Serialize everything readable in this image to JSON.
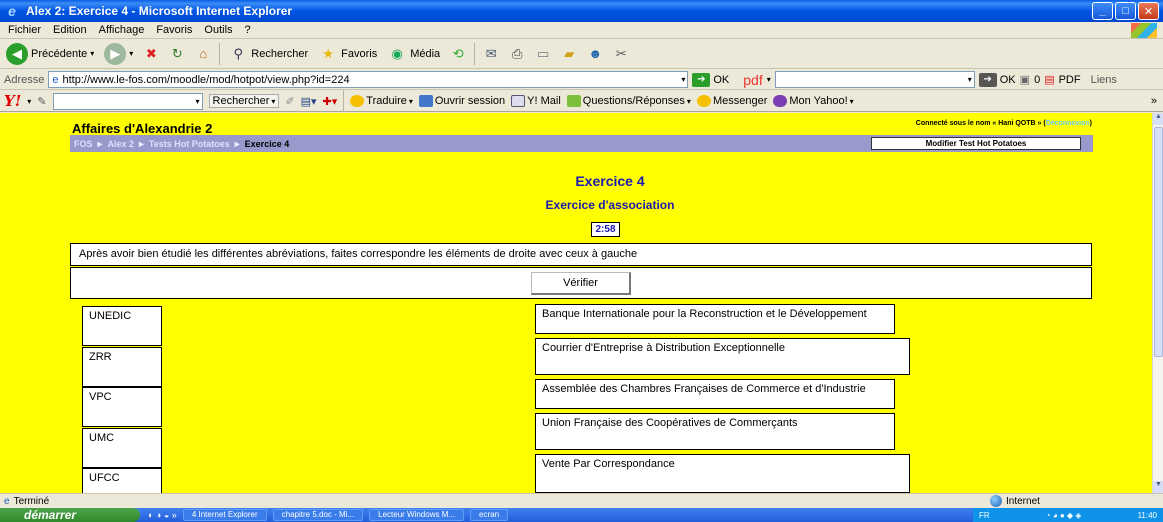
{
  "window": {
    "title": "Alex 2: Exercice 4 - Microsoft Internet Explorer"
  },
  "menu": [
    "Fichier",
    "Edition",
    "Affichage",
    "Favoris",
    "Outils",
    "?"
  ],
  "toolbar": {
    "back": "Précédente",
    "search": "Rechercher",
    "favorites": "Favoris",
    "media": "Média"
  },
  "address": {
    "label": "Adresse",
    "url": "http://www.le-fos.com/moodle/mod/hotpot/view.php?id=224",
    "go": "OK",
    "pdf_brand": "pdf",
    "go2": "OK",
    "count": "0",
    "pdf_label": "PDF",
    "links": "Liens"
  },
  "yahoo": {
    "search_btn": "Rechercher",
    "translate": "Traduire",
    "open_session": "Ouvrir session",
    "mail": "Y! Mail",
    "qa": "Questions/Réponses",
    "messenger": "Messenger",
    "my_yahoo": "Mon Yahoo!"
  },
  "page": {
    "site_title": "Affaires d'Alexandrie 2",
    "login_text": "Connecté sous le nom « Hani QOTB » (",
    "logout": "Déconnexion",
    "login_close": ")",
    "breadcrumb": [
      "FOS",
      "Alex 2",
      "Tests Hot Potatoes",
      "Exercice 4"
    ],
    "breadcrumb_sep": "►",
    "edit_button": "Modifier Test Hot Potatoes",
    "exercise_title": "Exercice 4",
    "exercise_subtitle": "Exercice d'association",
    "timer": "2:58",
    "instructions": "Après avoir bien étudié les différentes abréviations, faites correspondre les éléments de droite avec ceux à gauche",
    "check_button": "Vérifier",
    "left_items": [
      "UNEDIC",
      "ZRR",
      "VPC",
      "UMC",
      "UFCC"
    ],
    "right_items": [
      "Banque Internationale pour la Reconstruction et le Développement",
      "Courrier d'Entreprise à Distribution Exceptionnelle",
      "Assemblée des Chambres Françaises de Commerce et d'Industrie",
      "Union Française des Coopératives de Commerçants",
      "Vente Par Correspondance"
    ]
  },
  "status": {
    "text": "Terminé",
    "zone": "Internet"
  },
  "taskbar": {
    "start": "démarrer",
    "tasks": [
      "4 Internet Explorer",
      "chapitre 5.doc - Mi...",
      "Lecteur Windows M...",
      "ecran"
    ],
    "lang": "FR",
    "clock": "11:40"
  },
  "colors": {
    "page_bg": "#ffff00",
    "nav_bg": "#9999cc",
    "title_blue": "#1a1aaf"
  }
}
